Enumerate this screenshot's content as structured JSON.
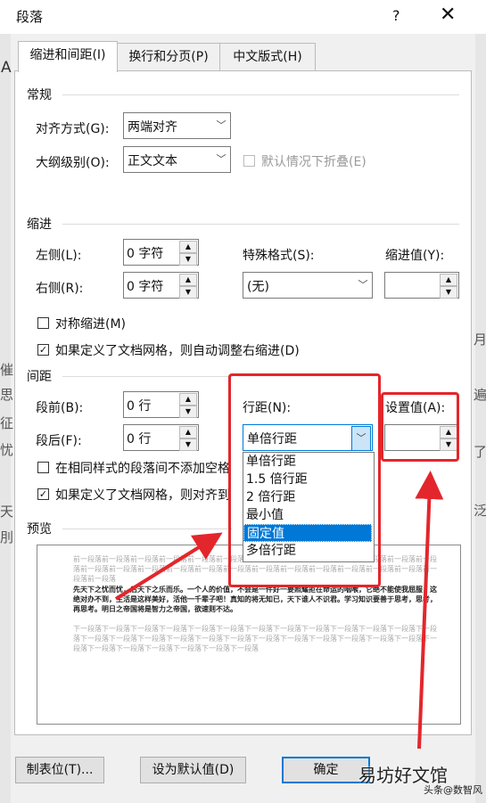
{
  "window": {
    "title": "段落",
    "help": "?",
    "close": "✕"
  },
  "bg_glyphs": {
    "a": "A",
    "l1": "催",
    "l2": "思",
    "l3": "征",
    "l4": "忧",
    "l5": "天",
    "l6": "刖",
    "r1": "月",
    "r2": "遍",
    "r3": "了",
    "r4": "泛"
  },
  "tabs": [
    {
      "label": "缩进和间距(I)",
      "active": true
    },
    {
      "label": "换行和分页(P)",
      "active": false
    },
    {
      "label": "中文版式(H)",
      "active": false
    }
  ],
  "general": {
    "heading": "常规",
    "alignment_label": "对齐方式(G):",
    "alignment_value": "两端对齐",
    "outline_label": "大纲级别(O):",
    "outline_value": "正文文本",
    "collapse_label": "默认情况下折叠(E)"
  },
  "indent": {
    "heading": "缩进",
    "left_label": "左侧(L):",
    "left_value": "0 字符",
    "right_label": "右侧(R):",
    "right_value": "0 字符",
    "special_label": "特殊格式(S):",
    "special_value": "(无)",
    "by_label": "缩进值(Y):",
    "by_value": "",
    "mirror_label": "对称缩进(M)",
    "auto_adjust_label": "如果定义了文档网格，则自动调整右缩进(D)"
  },
  "spacing": {
    "heading": "间距",
    "before_label": "段前(B):",
    "before_value": "0 行",
    "after_label": "段后(F):",
    "after_value": "0 行",
    "line_label": "行距(N):",
    "line_value": "单倍行距",
    "at_label": "设置值(A):",
    "at_value": "",
    "no_space_label": "在相同样式的段落间不添加空格",
    "snap_grid_label": "如果定义了文档网格，则对齐到",
    "line_options": [
      "单倍行距",
      "1.5 倍行距",
      "2 倍行距",
      "最小值",
      "固定值",
      "多倍行距"
    ],
    "selected_option": "固定值"
  },
  "preview": {
    "heading": "预览",
    "prev_text": "前一段落前一段落前一段落前一段落前一段落前一段落前一段落前一段落前一段落前一段落前一段落前一段落前一段落前一段落前一段落前一段落前一段落前一段落前一段落前一段落前一段落前一段落前一段落前一段落前一段落前一段落前一段落",
    "sample_text": "先天下之忧而忧，后天下之乐而乐。一个人的价值，不会是一件好一要照耀拒在命运的咽喉，它绝不能使我屈服，这绝对办不到，生活是这样美好，活他一千辈子吧！真知的将无知已，天下谁人不识君。学习知识要善于思考，思考，再思考。明日之帝国将是智力之帝国，欲速则不达。",
    "next_text": "下一段落下一段落下一段落下一段落下一段落下一段落下一段落下一段落下一段落下一段落下一段落下一段落下一段落下一段落下一段落下一段落下一段落下一段落下一段落下一段落下一段落下一段落下一段落下一段落下一段落下一段落下一段落下一段落下一段落下一段落下一段落下一段落"
  },
  "buttons": {
    "tabs": "制表位(T)...",
    "set_default": "设为默认值(D)",
    "ok": "确定"
  },
  "watermark": {
    "main": "易坊好文馆",
    "sub": "头条@数智风"
  },
  "colors": {
    "highlight": "#0078d7",
    "annotation": "#e3262c"
  }
}
